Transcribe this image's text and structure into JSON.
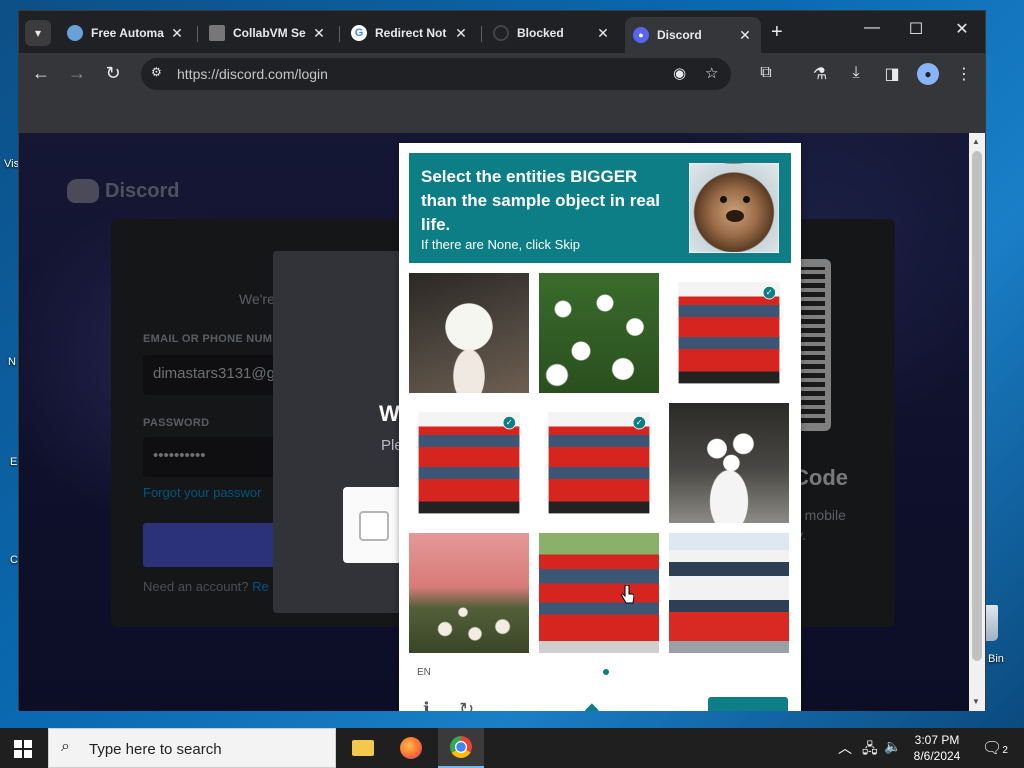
{
  "desktop": {
    "icon_labels": [
      "Vis",
      "N",
      "E",
      "C"
    ],
    "recycle_bin_label": "Bin"
  },
  "browser": {
    "tabs": [
      {
        "label": "Free Automa",
        "favicon": "automation-favicon",
        "color": "#6aa0d8"
      },
      {
        "label": "CollabVM Se",
        "favicon": "collabvm-favicon",
        "color": "#888888"
      },
      {
        "label": "Redirect Not",
        "favicon": "google-favicon",
        "color": "#4285f4"
      },
      {
        "label": "Blocked",
        "favicon": "blocked-favicon",
        "color": "#444444"
      },
      {
        "label": "Discord",
        "favicon": "discord-favicon",
        "color": "#5865f2",
        "active": true
      }
    ],
    "new_tab": "+",
    "window_controls": {
      "minimize": "—",
      "maximize": "☐",
      "close": "✕"
    },
    "url": "https://discord.com/login"
  },
  "discord": {
    "logo_text": "Discord",
    "welcome": "We're",
    "email_label": "EMAIL OR PHONE NUMBER",
    "email_value": "dimastars3131@g",
    "password_label": "PASSWORD",
    "password_value": "••••••••••",
    "forgot": "Forgot your passwor",
    "need_account": "Need an account?",
    "register": "Re",
    "qr_title": "Code",
    "qr_sub_1": "d mobile",
    "qr_sub_2": "ly."
  },
  "modal": {
    "title": "W",
    "subtitle": "Ple"
  },
  "captcha": {
    "prompt": "Select the entities BIGGER than the sample object in real life.",
    "prompt_sub": "If there are None, click Skip",
    "sample": "bear",
    "tiles": [
      {
        "subject": "daisies-in-pot",
        "selected": false
      },
      {
        "subject": "daisy-field",
        "selected": false
      },
      {
        "subject": "double-decker-bus",
        "selected": true
      },
      {
        "subject": "double-decker-bus",
        "selected": true
      },
      {
        "subject": "double-decker-bus",
        "selected": true
      },
      {
        "subject": "daisies-in-vase",
        "selected": false
      },
      {
        "subject": "pink-sky-flowers",
        "selected": false
      },
      {
        "subject": "double-decker-bus",
        "selected": false
      },
      {
        "subject": "double-decker-bus",
        "selected": false
      }
    ],
    "language": "EN",
    "check_mark": "✓"
  },
  "taskbar": {
    "search_placeholder": "Type here to search",
    "time": "3:07 PM",
    "date": "8/6/2024",
    "notifications": "2"
  },
  "colors": {
    "captcha_accent": "#0d7e85",
    "discord_blurple": "#5865f2"
  }
}
